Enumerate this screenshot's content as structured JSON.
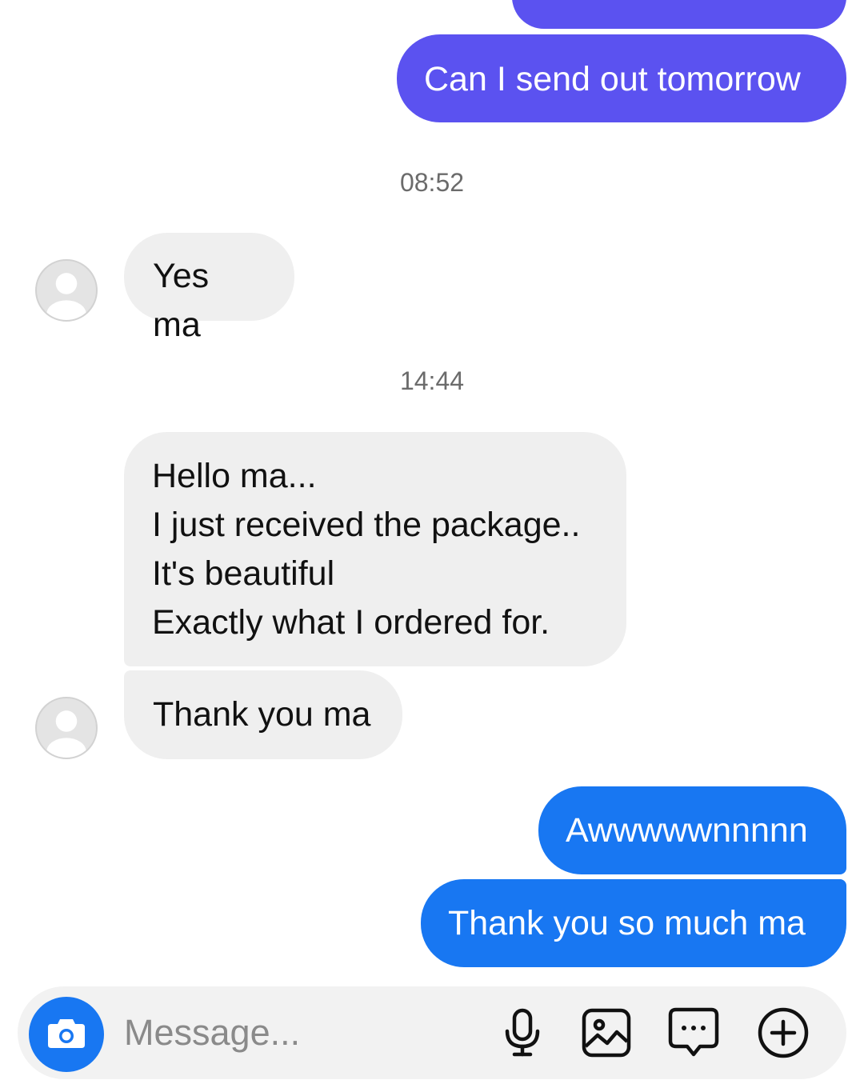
{
  "colors": {
    "outgoing_purple": "#5b52f0",
    "outgoing_blue": "#1877f2",
    "incoming_bg": "#efefef",
    "accent": "#1877f2"
  },
  "messages": [
    {
      "direction": "outgoing",
      "text": "Can I send out tomorrow"
    },
    {
      "direction": "timestamp",
      "text": "08:52"
    },
    {
      "direction": "incoming",
      "text": "Yes ma"
    },
    {
      "direction": "timestamp",
      "text": "14:44"
    },
    {
      "direction": "incoming",
      "text": "Hello ma...\nI just received the package..\nIt's beautiful\nExactly what I ordered for."
    },
    {
      "direction": "incoming",
      "text": "Thank you ma"
    },
    {
      "direction": "outgoing",
      "text": "Awwwwwnnnnn"
    },
    {
      "direction": "outgoing",
      "text": "Thank you so much ma"
    }
  ],
  "composer": {
    "placeholder": "Message...",
    "icons": [
      "camera-icon",
      "microphone-icon",
      "gallery-icon",
      "sticker-chat-icon",
      "plus-circle-icon"
    ]
  }
}
